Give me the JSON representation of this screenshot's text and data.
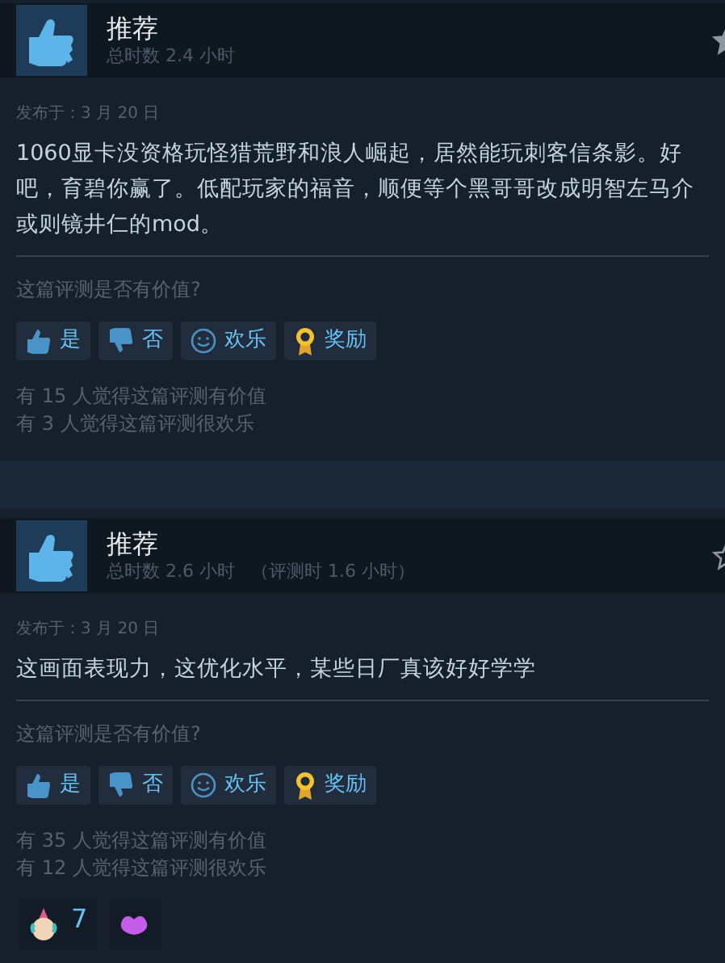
{
  "reviews": [
    {
      "verdict": "推荐",
      "playtime": "总时数 2.4 小时",
      "starred": true,
      "posted": "发布于：3 月 20 日",
      "body": "1060显卡没资格玩怪猎荒野和浪人崛起，居然能玩刺客信条影。好吧，育碧你赢了。低配玩家的福音，顺便等个黑哥哥改成明智左马介或则镜井仁的mod。",
      "prompt": "这篇评测是否有价值?",
      "buttons": [
        {
          "kind": "yes",
          "label": "是"
        },
        {
          "kind": "no",
          "label": "否"
        },
        {
          "kind": "funny",
          "label": "欢乐"
        },
        {
          "kind": "award",
          "label": "奖励"
        }
      ],
      "counts": [
        "有 15 人觉得这篇评测有价值",
        "有 3 人觉得这篇评测很欢乐"
      ]
    },
    {
      "verdict": "推荐",
      "playtime": "总时数 2.6 小时",
      "playtime_at_review": "（评测时 1.6 小时）",
      "starred": false,
      "posted": "发布于：3 月 20 日",
      "body": "这画面表现力，这优化水平，某些日厂真该好好学学",
      "prompt": "这篇评测是否有价值?",
      "buttons": [
        {
          "kind": "yes",
          "label": "是"
        },
        {
          "kind": "no",
          "label": "否"
        },
        {
          "kind": "funny",
          "label": "欢乐"
        },
        {
          "kind": "award",
          "label": "奖励"
        }
      ],
      "counts": [
        "有 35 人觉得这篇评测有价值",
        "有 12 人觉得这篇评测很欢乐"
      ],
      "reactions": [
        {
          "kind": "party",
          "count": "7"
        },
        {
          "kind": "blob"
        }
      ]
    }
  ]
}
